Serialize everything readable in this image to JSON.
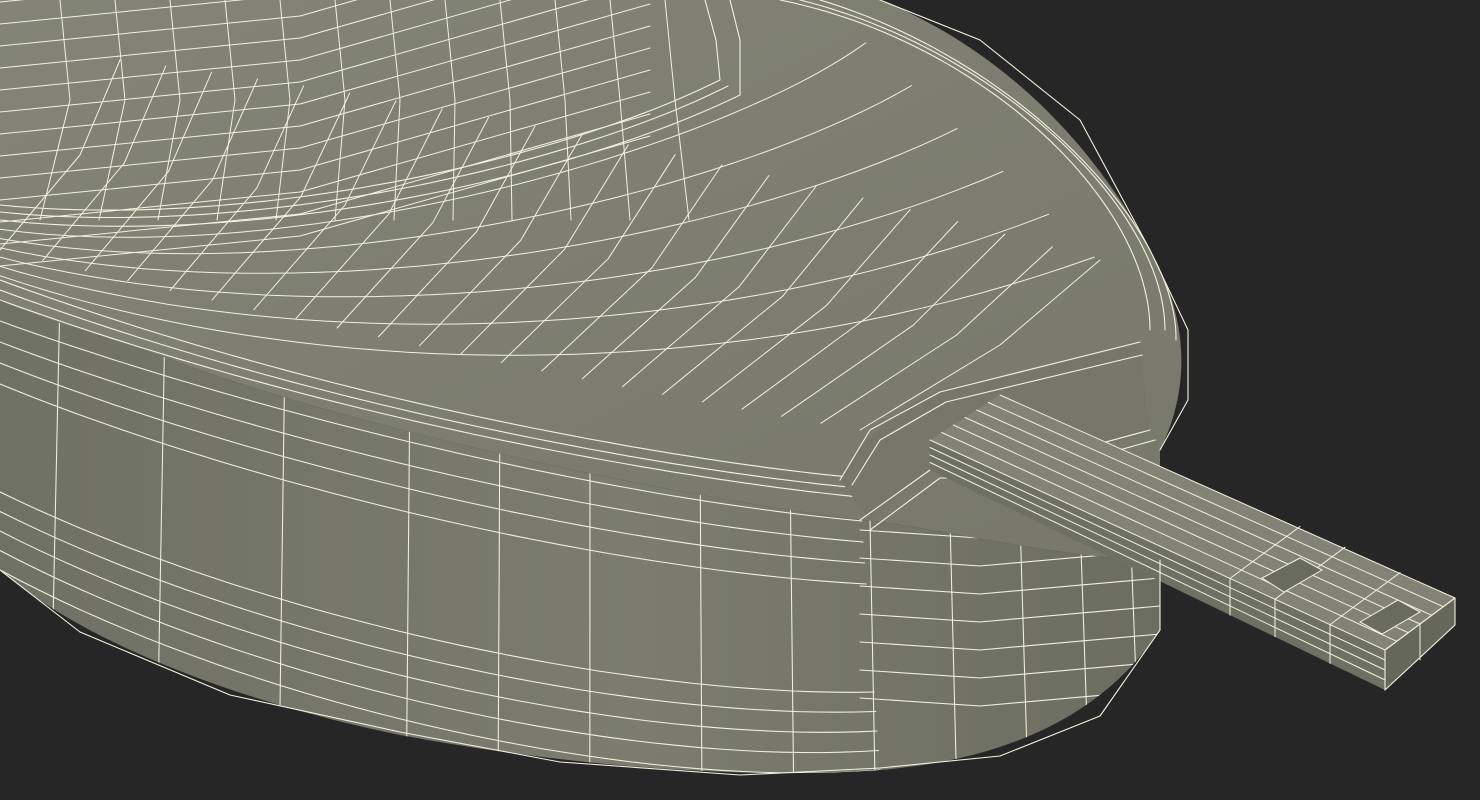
{
  "scene": {
    "background_color": "#262626",
    "surface_color": "#7c7d70",
    "surface_shadow_color": "#6d6e62",
    "wire_color": "#f3f1de"
  }
}
